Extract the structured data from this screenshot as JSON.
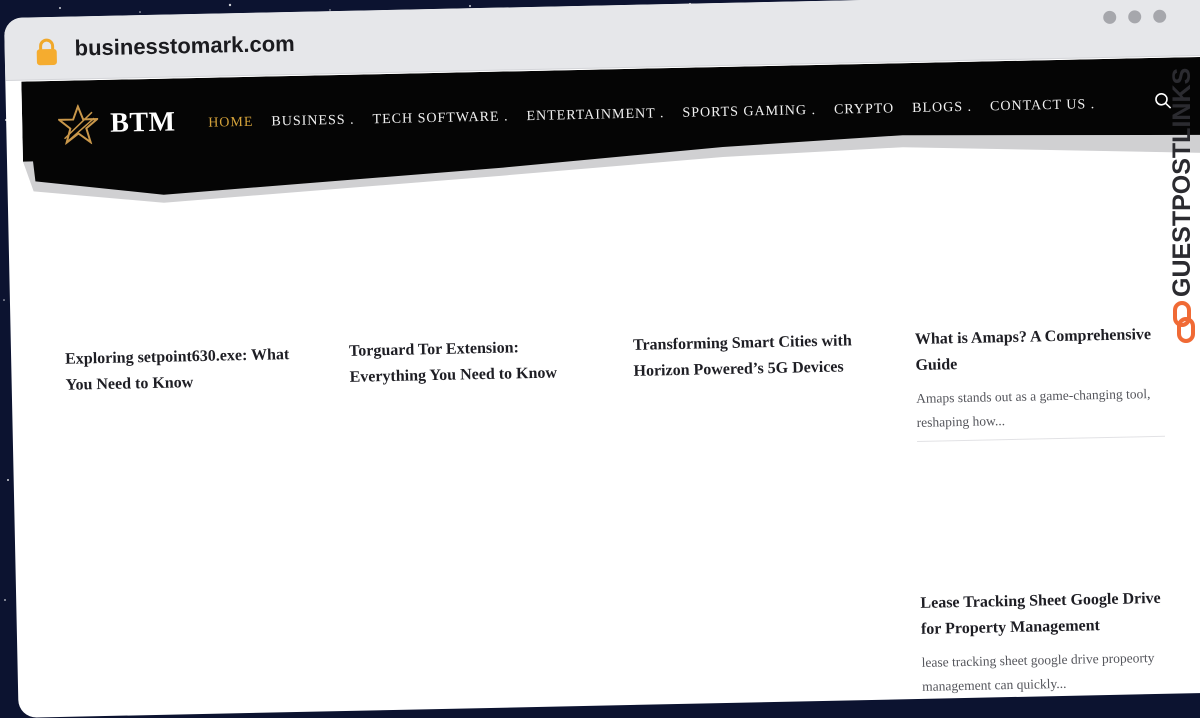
{
  "browser": {
    "url": "businesstomark.com"
  },
  "nav": {
    "logo_text": "BTM",
    "items": [
      {
        "label": "HOME",
        "active": true
      },
      {
        "label": "BUSINESS ."
      },
      {
        "label": "TECH SOFTWARE ."
      },
      {
        "label": "ENTERTAINMENT ."
      },
      {
        "label": "SPORTS GAMING ."
      },
      {
        "label": "CRYPTO"
      },
      {
        "label": "BLOGS ."
      },
      {
        "label": "CONTACT US ."
      }
    ]
  },
  "posts": [
    {
      "title": "Exploring setpoint630.exe: What You Need to Know"
    },
    {
      "title": "Torguard Tor Extension: Everything You Need to Know"
    },
    {
      "title": "Transforming Smart Cities with Horizon Powered’s 5G Devices"
    },
    {
      "title": "What is Amaps? A Comprehensive Guide",
      "excerpt": "Amaps stands out as a game-changing tool, reshaping how..."
    },
    {
      "title": "Lease Tracking Sheet Google Drive for Property Management",
      "excerpt": "lease tracking sheet google drive propeorty management can quickly..."
    }
  ],
  "watermark": {
    "text": "GUESTPOSTLINKS"
  },
  "colors": {
    "accent": "#d4a23a",
    "nav_bg": "#050505",
    "watermark_logo": "#f06a35",
    "watermark_text": "#2b2b30"
  }
}
